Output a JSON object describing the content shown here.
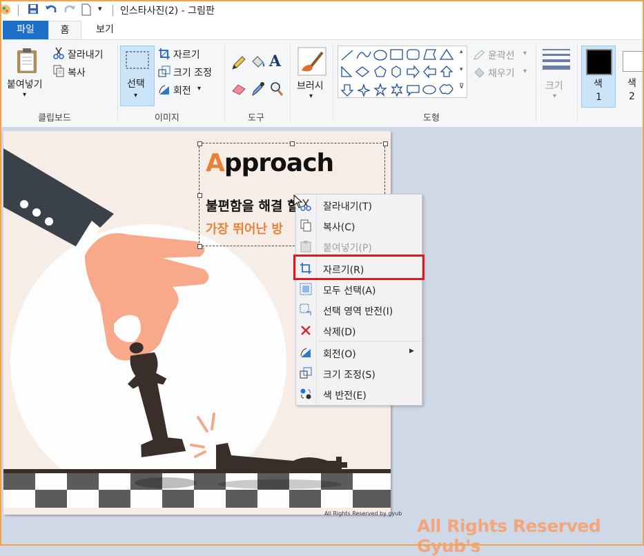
{
  "window": {
    "title": "인스타사진(2) - 그림판"
  },
  "tabs": [
    {
      "label": "파일"
    },
    {
      "label": "홈"
    },
    {
      "label": "보기"
    }
  ],
  "ribbon": {
    "clipboard": {
      "paste": "붙여넣기",
      "cut": "잘라내기",
      "copy": "복사",
      "group": "클립보드"
    },
    "image": {
      "select": "선택",
      "crop": "자르기",
      "resize": "크기 조정",
      "rotate": "회전",
      "group": "이미지"
    },
    "tools": {
      "group": "도구"
    },
    "brushes": {
      "label": "브러시"
    },
    "shapes": {
      "outline": "윤곽선",
      "fill": "채우기",
      "group": "도형"
    },
    "size": {
      "label": "크기"
    },
    "colors": {
      "color1_label": "색",
      "color1_num": "1",
      "color2_label": "색",
      "color2_num": "2",
      "color1_value": "#000000",
      "color2_value": "#ffffff"
    }
  },
  "canvas": {
    "headline_first": "A",
    "headline_rest": "pproach",
    "line1": "불편함을 해결 할",
    "line2": "가장 뛰어난 방",
    "copyright": "All Rights Reserved by gyub"
  },
  "context_menu": {
    "items": [
      {
        "label": "잘라내기(T)",
        "enabled": true
      },
      {
        "label": "복사(C)",
        "enabled": true
      },
      {
        "label": "붙여넣기(P)",
        "enabled": false
      },
      {
        "label": "자르기(R)",
        "enabled": true,
        "highlighted": true
      },
      {
        "label": "모두 선택(A)",
        "enabled": true
      },
      {
        "label": "선택 영역 반전(I)",
        "enabled": true
      },
      {
        "label": "삭제(D)",
        "enabled": true
      },
      {
        "label": "회전(O)",
        "enabled": true,
        "submenu": true
      },
      {
        "label": "크기 조정(S)",
        "enabled": true
      },
      {
        "label": "색 반전(E)",
        "enabled": true
      }
    ]
  },
  "watermark": "All Rights Reserved Gyub's",
  "accent_colors": {
    "highlight_border": "#e8141b",
    "file_tab": "#1e6fc8",
    "orange_text": "#e8823a"
  }
}
